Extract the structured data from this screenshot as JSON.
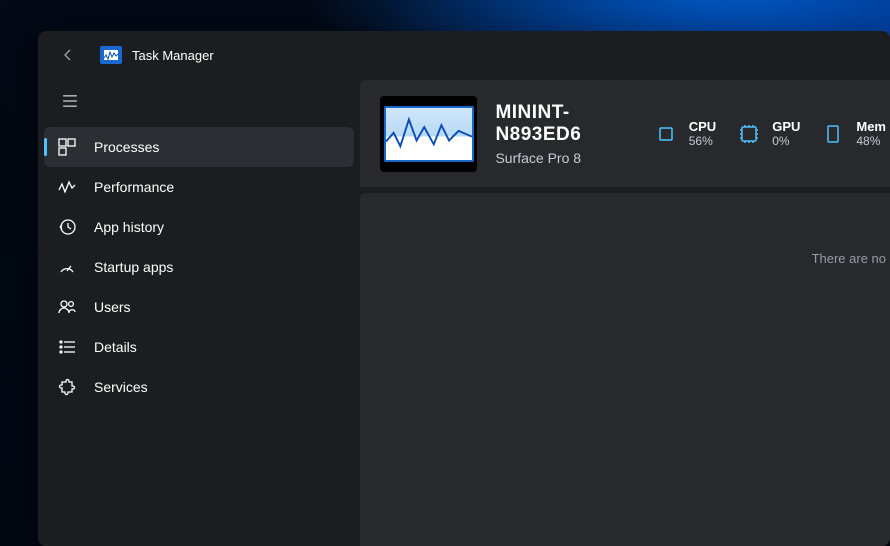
{
  "app": {
    "title": "Task Manager"
  },
  "sidebar": {
    "items": [
      {
        "label": "Processes",
        "icon": "grid",
        "selected": true
      },
      {
        "label": "Performance",
        "icon": "wave",
        "selected": false
      },
      {
        "label": "App history",
        "icon": "history",
        "selected": false
      },
      {
        "label": "Startup apps",
        "icon": "gauge",
        "selected": false
      },
      {
        "label": "Users",
        "icon": "users",
        "selected": false
      },
      {
        "label": "Details",
        "icon": "list",
        "selected": false
      },
      {
        "label": "Services",
        "icon": "puzzle",
        "selected": false
      }
    ]
  },
  "header": {
    "hostname": "MININT-N893ED6",
    "device_model": "Surface Pro 8",
    "stats": [
      {
        "label": "CPU",
        "value": "56%",
        "icon": "cpu"
      },
      {
        "label": "GPU",
        "value": "0%",
        "icon": "gpu"
      },
      {
        "label": "Mem",
        "value": "48%",
        "icon": "memory"
      }
    ]
  },
  "main": {
    "empty_message": "There are no"
  }
}
